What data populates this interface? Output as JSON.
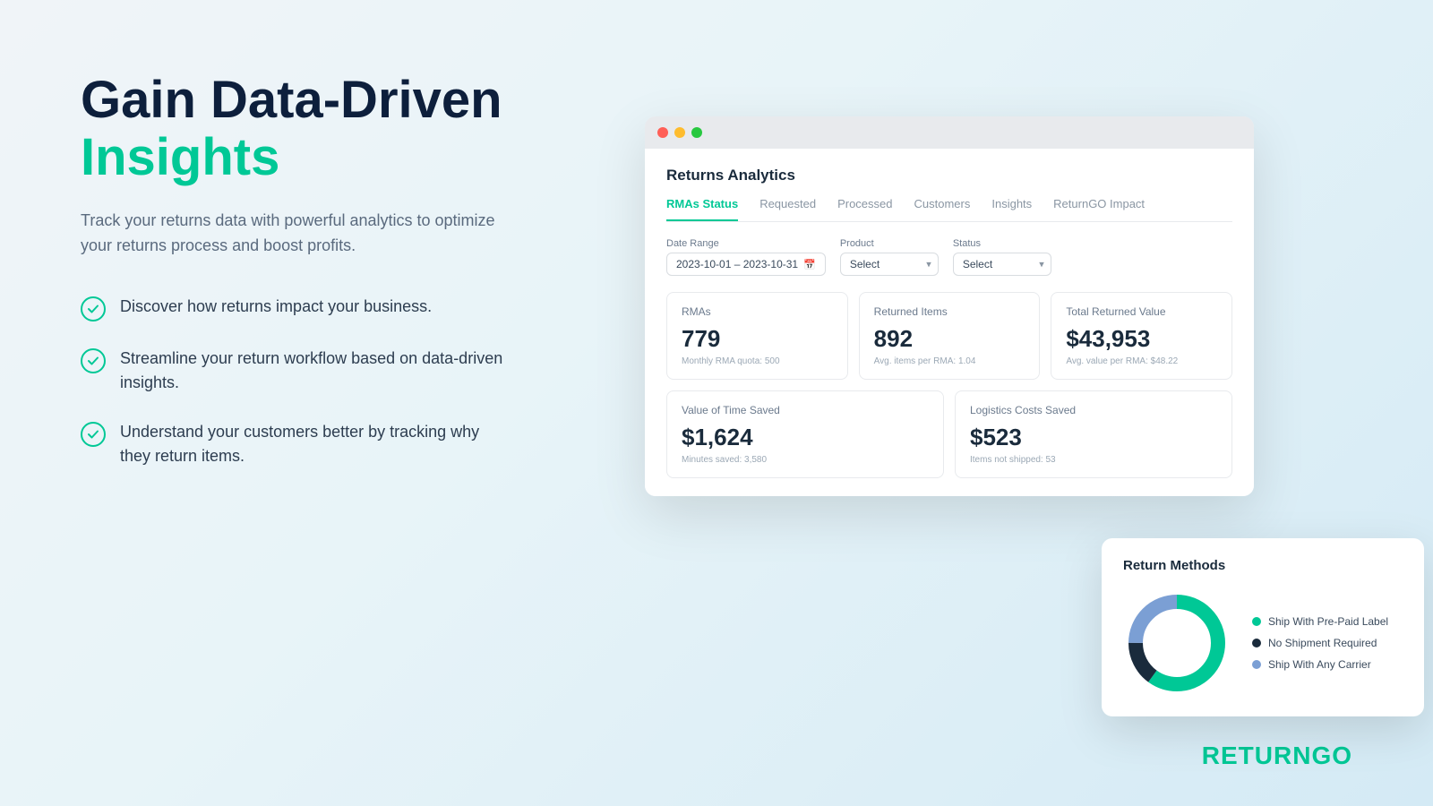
{
  "headline": {
    "line1": "Gain Data-Driven",
    "line2": "Insights"
  },
  "subtext": "Track your returns data with powerful analytics to optimize your returns process and boost profits.",
  "features": [
    {
      "text": "Discover how returns impact your business."
    },
    {
      "text": "Streamline your return workflow based on data-driven insights."
    },
    {
      "text": "Understand your customers better by tracking why they return items."
    }
  ],
  "browser": {
    "panel_title": "Returns Analytics",
    "tabs": [
      {
        "label": "RMAs Status",
        "active": true
      },
      {
        "label": "Requested",
        "active": false
      },
      {
        "label": "Processed",
        "active": false
      },
      {
        "label": "Customers",
        "active": false
      },
      {
        "label": "Insights",
        "active": false
      },
      {
        "label": "ReturnGO Impact",
        "active": false
      }
    ],
    "filters": {
      "date_range_label": "Date Range",
      "date_range_value": "2023-10-01 – 2023-10-31",
      "product_label": "Product",
      "product_value": "Select",
      "status_label": "Status",
      "status_value": "Select"
    },
    "stats": [
      {
        "label": "RMAs",
        "value": "779",
        "subtext": "Monthly RMA quota: 500"
      },
      {
        "label": "Returned Items",
        "value": "892",
        "subtext": "Avg. items per RMA: 1.04"
      },
      {
        "label": "Total Returned Value",
        "value": "$43,953",
        "subtext": "Avg. value per RMA: $48.22"
      }
    ],
    "stats2": [
      {
        "label": "Value of Time Saved",
        "value": "$1,624",
        "subtext": "Minutes saved: 3,580"
      },
      {
        "label": "Logistics Costs Saved",
        "value": "$523",
        "subtext": "Items not shipped: 53"
      }
    ]
  },
  "return_methods": {
    "title": "Return Methods",
    "segments": [
      {
        "label": "Ship With Pre-Paid Label",
        "color": "#00c896",
        "percent": 60
      },
      {
        "label": "No Shipment Required",
        "color": "#1a2b3c",
        "percent": 15
      },
      {
        "label": "Ship With Any Carrier",
        "color": "#7b9fd4",
        "percent": 25
      }
    ]
  },
  "logo": {
    "text_black": "RETURN",
    "text_green": "GO"
  }
}
